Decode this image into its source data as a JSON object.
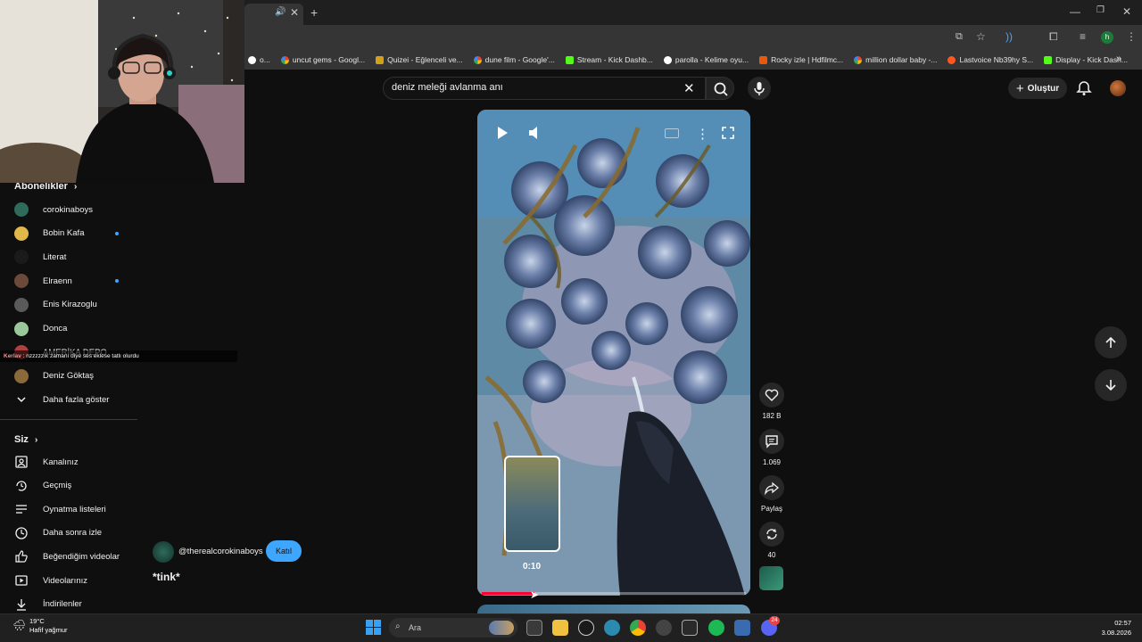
{
  "browser": {
    "bookmarks": [
      {
        "label": "o...",
        "fav": "w"
      },
      {
        "label": "uncut gems - Googl...",
        "fav": "g"
      },
      {
        "label": "Quizei - Eğlenceli ve...",
        "fav": "q"
      },
      {
        "label": "dune film - Google'...",
        "fav": "g"
      },
      {
        "label": "Stream - Kick Dashb...",
        "fav": "k"
      },
      {
        "label": "parolla - Kelime oyu...",
        "fav": "w"
      },
      {
        "label": "Rocky izle | Hdfilmc...",
        "fav": "r"
      },
      {
        "label": "million dollar baby -...",
        "fav": "g"
      },
      {
        "label": "Lastvoice Nb39hy S...",
        "fav": "o"
      },
      {
        "label": "Display - Kick Dash...",
        "fav": "k"
      }
    ],
    "more_bookmarks": "»"
  },
  "search": {
    "query": "deniz meleği avlanma anı"
  },
  "header": {
    "create_label": "Oluştur"
  },
  "sidebar": {
    "subscriptions_title": "Abonelikler",
    "subscriptions": [
      {
        "label": "corokinaboys",
        "color": "#2f6b5b",
        "dot": false
      },
      {
        "label": "Bobin Kafa",
        "color": "#e0b84a",
        "dot": true
      },
      {
        "label": "Literat",
        "color": "#1a1a1a",
        "dot": false
      },
      {
        "label": "Elraenn",
        "color": "#6b4a3a",
        "dot": true
      },
      {
        "label": "Enis Kirazoglu",
        "color": "#5a5a5a",
        "dot": false
      },
      {
        "label": "Donca",
        "color": "#9ac89a",
        "dot": false
      },
      {
        "label": "AMERİKA DEPO",
        "color": "#b04040",
        "dot": false
      },
      {
        "label": "Deniz Göktaş",
        "color": "#8a6a3a",
        "dot": false
      }
    ],
    "show_more": "Daha fazla göster",
    "you_title": "Siz",
    "you_items": [
      {
        "label": "Kanalınız",
        "icon": "account-box-icon"
      },
      {
        "label": "Geçmiş",
        "icon": "history-icon"
      },
      {
        "label": "Oynatma listeleri",
        "icon": "playlist-icon"
      },
      {
        "label": "Daha sonra izle",
        "icon": "clock-icon"
      },
      {
        "label": "Beğendiğim videolar",
        "icon": "thumbs-up-icon"
      },
      {
        "label": "Videolarınız",
        "icon": "video-icon"
      },
      {
        "label": "İndirilenler",
        "icon": "download-icon"
      }
    ]
  },
  "overlay_chat": {
    "user": "Kerlav",
    "message": "nzzzzzık zamanı diye ses eklese tatlı olurdu"
  },
  "short": {
    "preview_time": "0:10",
    "progress_fraction": 0.2,
    "channel": "@therealcorokinaboys",
    "join_label": "Katıl",
    "title": "*tink*",
    "likes": "182 B",
    "comments": "1.069",
    "share_label": "Paylaş",
    "remix_count": "40"
  },
  "taskbar": {
    "temperature": "19°C",
    "weather": "Hafif yağmur",
    "search_placeholder": "Ara",
    "time": "02:57",
    "date": "3.08.2026",
    "discord_badge": "24"
  }
}
